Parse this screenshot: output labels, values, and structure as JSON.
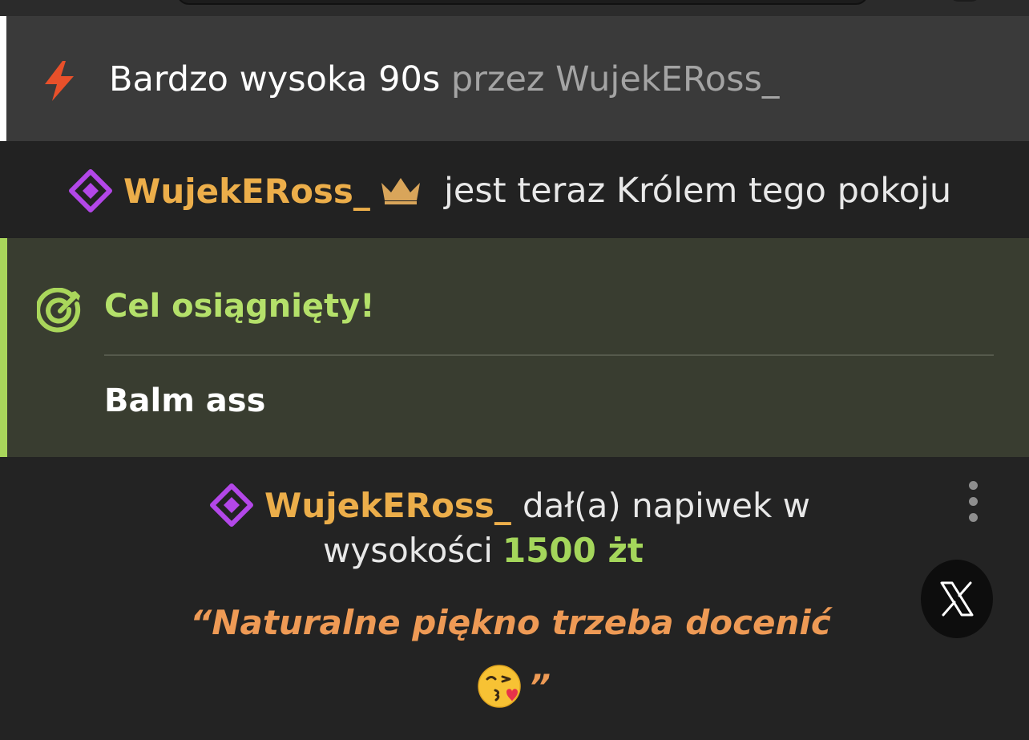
{
  "notifications": {
    "speed_event": {
      "level_text": "Bardzo wysoka 90s",
      "by_text": "przez WujekERoss_",
      "icon": "lightning-bolt-icon",
      "icon_color": "#e8502a"
    },
    "king_event": {
      "username": "WujekERoss_",
      "message": "jest teraz Królem tego pokoju",
      "icons": [
        "diamond-icon",
        "crown-icon"
      ]
    },
    "goal_event": {
      "title": "Cel osiągnięty!",
      "goal_name": "Balm ass",
      "icon": "target-icon",
      "accent_color": "#a9d65b"
    },
    "tip_event": {
      "username": "WujekERoss_",
      "message_line1": "dał(a) napiwek w",
      "message_line2": "wysokości",
      "amount": "1500 żt",
      "quote_line1": "“Naturalne piękno trzeba docenić",
      "quote_end": "”",
      "emoji": "kissing-face-with-heart-icon"
    }
  },
  "colors": {
    "username": "#ecae4a",
    "amount": "#a4d65b",
    "quote": "#ee9a55",
    "diamond": "#b347e8"
  },
  "controls": {
    "more_options": "kebab-menu-icon",
    "share_x": "x-logo-icon"
  }
}
